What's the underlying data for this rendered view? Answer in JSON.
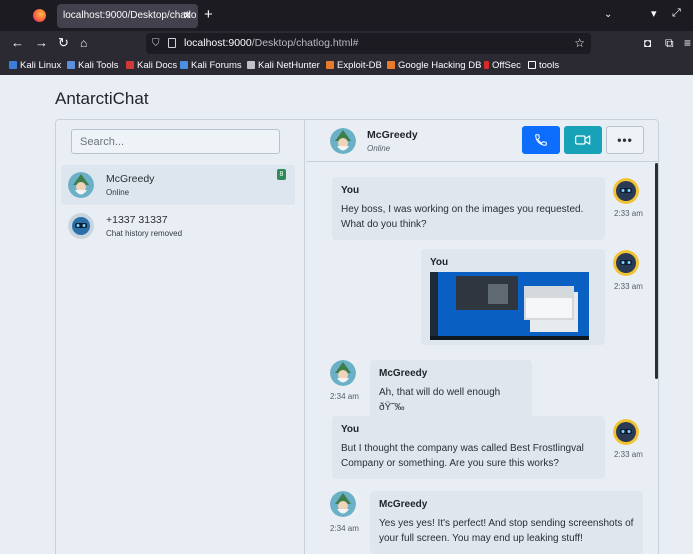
{
  "browser": {
    "tab_title": "localhost:9000/Desktop/chatlo",
    "url_host": "localhost:9000",
    "url_path": "/Desktop/chatlog.html#",
    "bookmarks": [
      "Kali Linux",
      "Kali Tools",
      "Kali Docs",
      "Kali Forums",
      "Kali NetHunter",
      "Exploit-DB",
      "Google Hacking DB",
      "OffSec",
      "tools"
    ]
  },
  "app": {
    "title": "AntarctiChat"
  },
  "sidebar": {
    "search_placeholder": "Search...",
    "contacts": [
      {
        "name": "McGreedy",
        "status": "Online",
        "badge": "8"
      },
      {
        "name": "+1337 31337",
        "status": "Chat history removed"
      }
    ]
  },
  "chat_header": {
    "name": "McGreedy",
    "status": "Online",
    "more_label": "•••"
  },
  "messages": [
    {
      "sender": "You",
      "text": "Hey boss, I was working on the images you requested. What do you think?",
      "time": "2:33 am"
    },
    {
      "sender": "You",
      "text": "",
      "time": "2:33 am",
      "attachment": "screenshot"
    },
    {
      "sender": "McGreedy",
      "text": "Ah, that will do well enough ðŸ˜‰",
      "time": "2:34 am"
    },
    {
      "sender": "You",
      "text": "But I thought the company was called Best Frostlingval Company or something. Are you sure this works?",
      "time": "2:33 am"
    },
    {
      "sender": "McGreedy",
      "text": "Yes yes yes! It's perfect! And stop sending screenshots of your full screen. You may end up leaking stuff!",
      "time": "2:34 am"
    }
  ],
  "icons": {
    "call": "phone-icon",
    "video": "video-camera-icon",
    "more": "more-options-icon"
  },
  "colors": {
    "call_button": "#0d6efd",
    "video_button": "#17a2b8",
    "badge": "#2e8b57",
    "browser_bg": "#2b2a33",
    "page_bg": "#e8eef4"
  }
}
